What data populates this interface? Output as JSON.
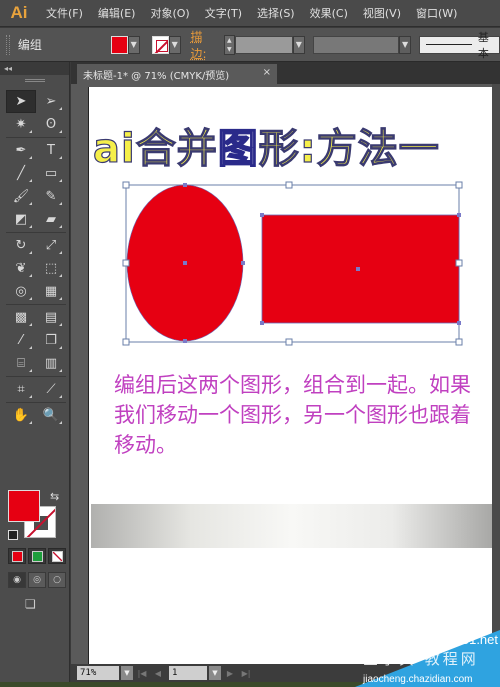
{
  "app": {
    "logo": "Ai"
  },
  "menu": [
    {
      "label": "文件(F)"
    },
    {
      "label": "编辑(E)"
    },
    {
      "label": "对象(O)"
    },
    {
      "label": "文字(T)"
    },
    {
      "label": "选择(S)"
    },
    {
      "label": "效果(C)"
    },
    {
      "label": "视图(V)"
    },
    {
      "label": "窗口(W)"
    }
  ],
  "control": {
    "selection_label": "编组",
    "fill_color": "#e60012",
    "stroke_label": "描边:",
    "stroke_width": "",
    "brush_style": "基本",
    "dropdown_glyph": "▼"
  },
  "tools_panel": {
    "collapse": "◂◂",
    "tools": [
      [
        "selection-tool",
        "direct-selection-tool"
      ],
      [
        "magic-wand-tool",
        "lasso-tool"
      ],
      [
        "pen-tool",
        "type-tool"
      ],
      [
        "line-segment-tool",
        "rectangle-tool"
      ],
      [
        "paintbrush-tool",
        "pencil-tool"
      ],
      [
        "blob-brush-tool",
        "eraser-tool"
      ],
      [
        "rotate-tool",
        "scale-tool"
      ],
      [
        "warp-tool",
        "free-transform-tool"
      ],
      [
        "shape-builder-tool",
        "perspective-grid-tool"
      ],
      [
        "mesh-tool",
        "gradient-tool"
      ],
      [
        "eyedropper-tool",
        "blend-tool"
      ],
      [
        "symbol-sprayer-tool",
        "column-graph-tool"
      ],
      [
        "artboard-tool",
        "slice-tool"
      ],
      [
        "hand-tool",
        "zoom-tool"
      ]
    ],
    "glyphs": {
      "selection-tool": "➤",
      "direct-selection-tool": "➢",
      "magic-wand-tool": "✷",
      "lasso-tool": "ʘ",
      "pen-tool": "✒",
      "type-tool": "T",
      "line-segment-tool": "╱",
      "rectangle-tool": "▭",
      "paintbrush-tool": "🖌",
      "pencil-tool": "✎",
      "blob-brush-tool": "◩",
      "eraser-tool": "▰",
      "rotate-tool": "↻",
      "scale-tool": "⤢",
      "warp-tool": "❦",
      "free-transform-tool": "⬚",
      "shape-builder-tool": "◎",
      "perspective-grid-tool": "▦",
      "mesh-tool": "▩",
      "gradient-tool": "▤",
      "eyedropper-tool": "⁄",
      "blend-tool": "❐",
      "symbol-sprayer-tool": "⌸",
      "column-graph-tool": "▥",
      "artboard-tool": "⌗",
      "slice-tool": "⟋",
      "hand-tool": "✋",
      "zoom-tool": "🔍"
    },
    "fill_color": "#e60012",
    "stroke_color": "none",
    "mode_colors": [
      "#e60012",
      "#1e9e3c",
      "none"
    ],
    "swap_glyph": "⇆",
    "screen_mode_glyph": "❏"
  },
  "document": {
    "tab_title": "未标题-1* @ 71% (CMYK/预览)",
    "tab_close": "×",
    "title_text_parts": [
      "ai合并",
      "图",
      "形:方法一"
    ],
    "description": "编组后这两个图形，组合到一起。如果我们移动一个图形，另一个图形也跟着移动。",
    "shape_fill": "#e60012",
    "selection_color": "#6a7fa8"
  },
  "status": {
    "zoom": "71%",
    "page": "1",
    "first": "|◀",
    "prev": "◀",
    "next": "▶",
    "last": "▶|"
  },
  "watermark": {
    "top": "jb51.net",
    "middle": "查字典 教程网",
    "bottom": "jiaocheng.chazidian.com"
  }
}
